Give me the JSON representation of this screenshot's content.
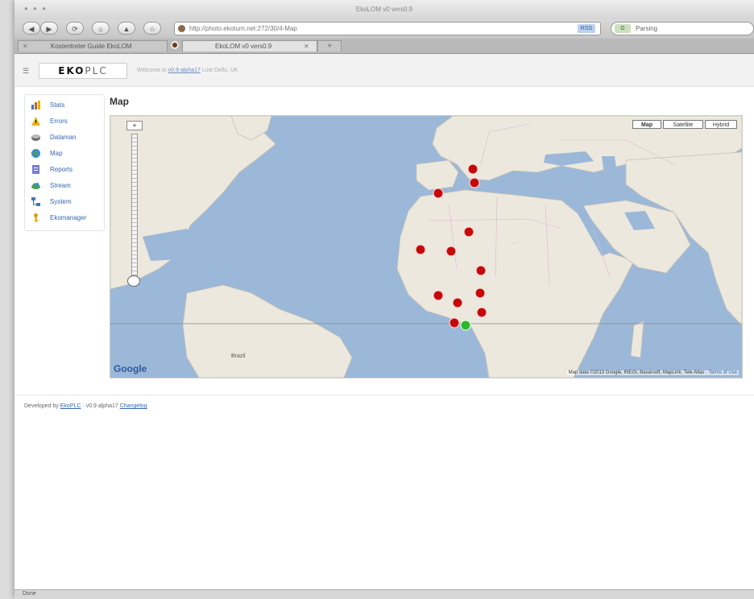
{
  "window": {
    "title": "EkoLOM v0 vers0.9"
  },
  "toolbar": {
    "back": "◀",
    "forward": "▶",
    "reload": "⟳",
    "home": "⌂",
    "share": "▲",
    "url": "http://photo.ekoturn.net:272/30/4-Map",
    "rss": "RSS",
    "search_engine": "G",
    "search_value": "Parsing"
  },
  "tabs": [
    {
      "label": "Kostentreter Guide EkoLOM",
      "active": false
    },
    {
      "label": "EkoLOM v0 vers0.9",
      "active": true
    }
  ],
  "header": {
    "logo_strong": "EKO",
    "logo_light": "PLC",
    "welcome_prefix": "Welcome to",
    "welcome_link": "v0.9 alpha17",
    "welcome_suffix": "Lost Dello, UK"
  },
  "sidebar": {
    "items": [
      {
        "label": "Stats",
        "icon": "bar-chart-icon",
        "color": "#d0602a"
      },
      {
        "label": "Errors",
        "icon": "warning-icon",
        "color": "#e5b400"
      },
      {
        "label": "Dataman",
        "icon": "database-icon",
        "color": "#6a6a6a"
      },
      {
        "label": "Map",
        "icon": "globe-icon",
        "color": "#3a8fd0"
      },
      {
        "label": "Reports",
        "icon": "report-icon",
        "color": "#7a7ad0"
      },
      {
        "label": "Stream",
        "icon": "cloud-icon",
        "color": "#4aa04a"
      },
      {
        "label": "System",
        "icon": "network-icon",
        "color": "#3a7ac0"
      },
      {
        "label": "Ekomanager",
        "icon": "key-icon",
        "color": "#e0a000"
      }
    ]
  },
  "map": {
    "title": "Map",
    "types": [
      "Map",
      "Satellite",
      "Hybrid"
    ],
    "selected_type": "Map",
    "zoom_in": "+",
    "zoom_out": "−",
    "provider": "Google",
    "attribution": "Map data ©2013 Google, INEGI, Basarsoft, MapLink, Tele Atlas",
    "terms": "Terms of Use",
    "colors": {
      "ocean": "#9cb8d8",
      "land": "#ece8de",
      "marker_red": "#c4090b",
      "marker_green": "#2db52d"
    }
  },
  "footer": {
    "prefix": "Developed by",
    "link": "EkoPLC",
    "middle": "v0.9 alpha17",
    "changelog": "Changelog"
  },
  "status": {
    "text": "Done"
  }
}
